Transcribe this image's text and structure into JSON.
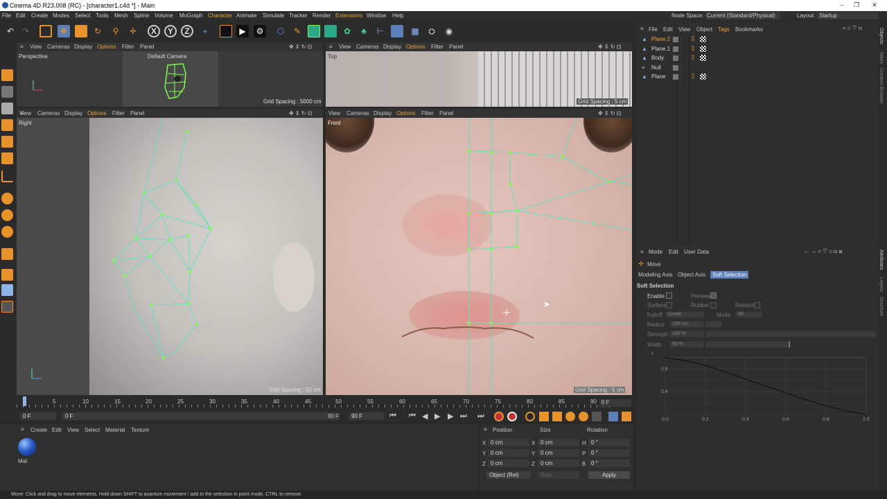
{
  "app": {
    "title": "Cinema 4D R23.008 (RC) - [character1.c4d *] - Main"
  },
  "window_buttons": [
    "–",
    "❐",
    "✕"
  ],
  "menu": [
    "File",
    "Edit",
    "Create",
    "Modes",
    "Select",
    "Tools",
    "Mesh",
    "Spline",
    "Volume",
    "MoGraph",
    "Character",
    "Animate",
    "Simulate",
    "Tracker",
    "Render",
    "Extensions",
    "Window",
    "Help"
  ],
  "node_space": {
    "label": "Node Space:",
    "value": "Current (Standard/Physical)"
  },
  "layout": {
    "label": "Layout:",
    "value": "Startup"
  },
  "viewport_menu": [
    "View",
    "Cameras",
    "Display",
    "Options",
    "Filter",
    "Panel"
  ],
  "viewports": {
    "perspective": {
      "label": "Perspective",
      "camera": "Default Camera",
      "grid": "Grid Spacing : 5000 cm"
    },
    "top": {
      "label": "Top",
      "grid": "Grid Spacing : 5 cm"
    },
    "right": {
      "label": "Right",
      "grid": "Grid Spacing : 50 cm"
    },
    "front": {
      "label": "Front",
      "grid": "Grid Spacing : 5 cm"
    }
  },
  "object_manager": {
    "menu": [
      "File",
      "Edit",
      "View",
      "Object",
      "Tags",
      "Bookmarks"
    ],
    "objects": [
      {
        "name": "Plane.2",
        "selected": true
      },
      {
        "name": "Plane.1",
        "selected": false
      },
      {
        "name": "Body",
        "selected": false
      },
      {
        "name": "Null",
        "selected": false
      },
      {
        "name": "Plane",
        "selected": false
      }
    ],
    "side_tabs": [
      "Objects",
      "Takes",
      "Content Browser"
    ]
  },
  "attributes": {
    "menu": [
      "Mode",
      "Edit",
      "User Data"
    ],
    "tool": "Move",
    "tabs": [
      "Modeling Axis",
      "Object Axis",
      "Soft Selection"
    ],
    "active_tab": "Soft Selection",
    "section": "Soft Selection",
    "enable": "Enable",
    "preview": "Preview",
    "surface": "Surface",
    "rubber": "Rubber",
    "restrict": "Restrict",
    "falloff_label": "Falloff",
    "falloff_value": "Linear",
    "mode_label": "Mode",
    "mode_value": "All",
    "radius_label": "Radius",
    "radius_value": "100 cm",
    "strength_label": "Strength",
    "strength_value": "100 %",
    "width_label": "Width",
    "width_value": "50 %",
    "side_tabs": [
      "Attributes",
      "Layers",
      "Structure"
    ]
  },
  "falloff_curve": {
    "type": "line",
    "x": [
      0.0,
      0.2,
      0.4,
      0.6,
      0.8,
      1.0
    ],
    "y": [
      1.0,
      0.8,
      0.6,
      0.4,
      0.2,
      0.0
    ],
    "xticks": [
      "0.0",
      "0.2",
      "0.4",
      "0.6",
      "0.8",
      "1.0"
    ],
    "yticks": [
      "0.8",
      "0.4"
    ],
    "curve": [
      [
        0,
        1
      ],
      [
        0.1,
        0.95
      ],
      [
        0.2,
        0.86
      ],
      [
        0.3,
        0.75
      ],
      [
        0.4,
        0.62
      ],
      [
        0.5,
        0.5
      ],
      [
        0.6,
        0.38
      ],
      [
        0.7,
        0.26
      ],
      [
        0.8,
        0.15
      ],
      [
        0.9,
        0.06
      ],
      [
        1,
        0
      ]
    ]
  },
  "timeline": {
    "ticks": [
      "0",
      "5",
      "10",
      "15",
      "20",
      "25",
      "30",
      "35",
      "40",
      "45",
      "50",
      "55",
      "60",
      "65",
      "70",
      "75",
      "80",
      "85",
      "90"
    ],
    "current": "0 F",
    "start": "0 F",
    "start2": "0 F",
    "end": "90 F",
    "end2": "90 F"
  },
  "material_manager": {
    "menu": [
      "Create",
      "Edit",
      "View",
      "Select",
      "Material",
      "Texture"
    ],
    "material": "Mat"
  },
  "coordinates": {
    "headers": [
      "Position",
      "Size",
      "Rotation"
    ],
    "rows": [
      {
        "axis": "X",
        "pos": "0 cm",
        "s": "X",
        "size": "0 cm",
        "r": "H",
        "rot": "0 °"
      },
      {
        "axis": "Y",
        "pos": "0 cm",
        "s": "Y",
        "size": "0 cm",
        "r": "P",
        "rot": "0 °"
      },
      {
        "axis": "Z",
        "pos": "0 cm",
        "s": "Z",
        "size": "0 cm",
        "r": "B",
        "rot": "0 °"
      }
    ],
    "mode": "Object (Rel)",
    "size_mode": "Size",
    "apply": "Apply"
  },
  "status": "Move: Click and drag to move elements. Hold down SHIFT to quantize movement / add to the selection in point mode, CTRL to remove.",
  "colors": {
    "accent": "#5c7fb8",
    "mesh": "#5fe0c0",
    "vertex": "#7cff4a",
    "orange": "#e8922a"
  }
}
